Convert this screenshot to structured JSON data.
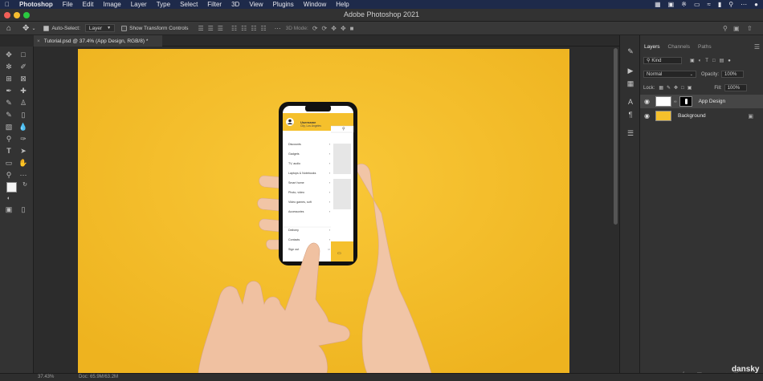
{
  "menubar": {
    "app_name": "Photoshop",
    "items": [
      "File",
      "Edit",
      "Image",
      "Layer",
      "Type",
      "Select",
      "Filter",
      "3D",
      "View",
      "Plugins",
      "Window",
      "Help"
    ]
  },
  "window": {
    "title": "Adobe Photoshop 2021"
  },
  "options_bar": {
    "auto_select_label": "Auto-Select:",
    "auto_select_value": "Layer",
    "transform_controls_label": "Show Transform Controls",
    "mode_3d": "3D Mode:"
  },
  "document_tab": {
    "label": "Tutorial.psd @ 37.4% (App Design, RGB/8) *"
  },
  "layers_panel": {
    "tabs": [
      "Layers",
      "Channels",
      "Paths"
    ],
    "filter_label": "Kind",
    "blend_mode": "Normal",
    "opacity_label": "Opacity:",
    "opacity_value": "100%",
    "lock_label": "Lock:",
    "fill_label": "Fill:",
    "fill_value": "100%",
    "layers": [
      {
        "name": "App Design",
        "visible": true
      },
      {
        "name": "Background",
        "visible": true,
        "locked": true
      }
    ]
  },
  "phone_app": {
    "user_name": "Username",
    "user_location": "City, Los Angeles",
    "menu_items": [
      "Discounts",
      "Gadgets",
      "TV, audio",
      "Laptops & Notebooks",
      "Smart home",
      "Photo, video",
      "Video games, soft",
      "Accessories"
    ],
    "footer_items": [
      "Delivery",
      "Contacts",
      "Sign out"
    ]
  },
  "status_bar": {
    "zoom": "37.43%",
    "doc_info": "Doc: 65.9M/63.2M"
  },
  "watermark": "dansky",
  "colors": {
    "canvas_yellow": "#f5c02c",
    "ui_dark": "#333333",
    "menubar": "#1e2a4a"
  }
}
